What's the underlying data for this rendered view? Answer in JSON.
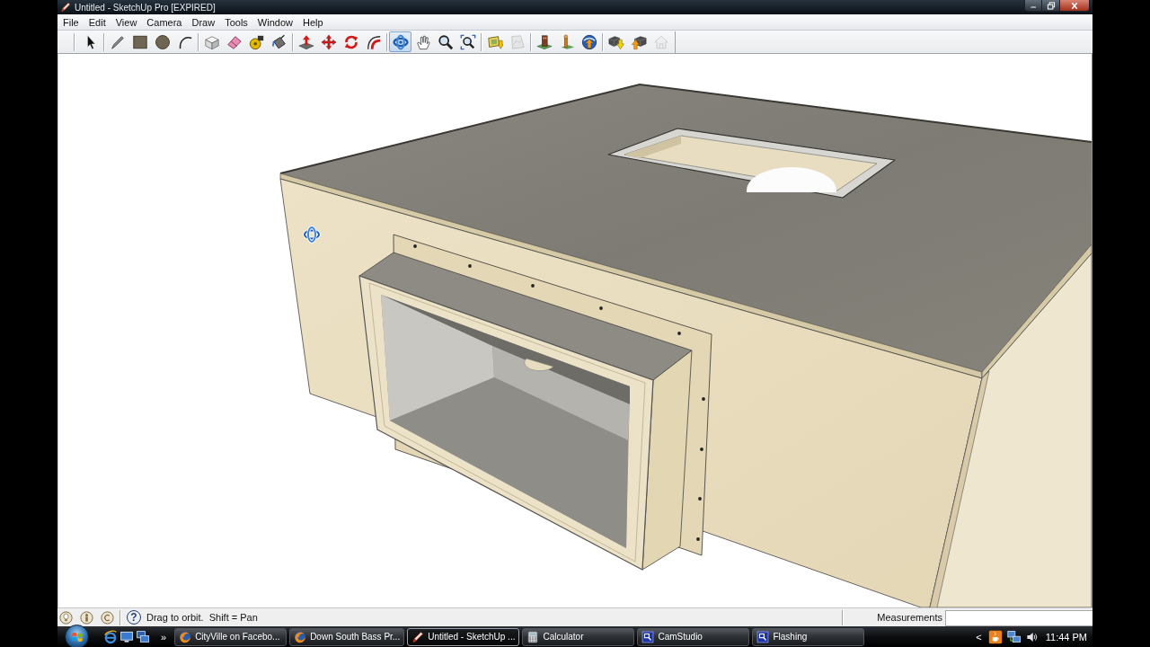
{
  "window": {
    "title": "Untitled - SketchUp Pro [EXPIRED]"
  },
  "menu": [
    "File",
    "Edit",
    "View",
    "Camera",
    "Draw",
    "Tools",
    "Window",
    "Help"
  ],
  "toolbar": {
    "groups": [
      {
        "tools": [
          {
            "kind": "arrow",
            "selected": false,
            "disabled": false
          }
        ]
      },
      {
        "tools": [
          {
            "kind": "pencil",
            "selected": false,
            "disabled": false
          },
          {
            "kind": "square",
            "selected": false,
            "disabled": false
          },
          {
            "kind": "circle",
            "selected": false,
            "disabled": false
          },
          {
            "kind": "arc",
            "selected": false,
            "disabled": false
          }
        ]
      },
      {
        "tools": [
          {
            "kind": "box",
            "selected": false,
            "disabled": false
          },
          {
            "kind": "eraser",
            "selected": false,
            "disabled": false
          },
          {
            "kind": "tape",
            "selected": false,
            "disabled": false
          },
          {
            "kind": "bucket",
            "selected": false,
            "disabled": false
          }
        ]
      },
      {
        "tools": [
          {
            "kind": "pushpull",
            "selected": false,
            "disabled": false
          },
          {
            "kind": "move",
            "selected": false,
            "disabled": false
          },
          {
            "kind": "rotate",
            "selected": false,
            "disabled": false
          },
          {
            "kind": "offset",
            "selected": false,
            "disabled": false
          }
        ]
      },
      {
        "tools": [
          {
            "kind": "orbit",
            "selected": true,
            "disabled": false
          },
          {
            "kind": "hand",
            "selected": false,
            "disabled": false
          },
          {
            "kind": "magnifier",
            "selected": false,
            "disabled": false
          },
          {
            "kind": "extents",
            "selected": false,
            "disabled": false
          }
        ]
      },
      {
        "tools": [
          {
            "kind": "photo",
            "selected": false,
            "disabled": false
          },
          {
            "kind": "terrain",
            "selected": false,
            "disabled": true
          }
        ]
      },
      {
        "tools": [
          {
            "kind": "building",
            "selected": false,
            "disabled": false
          },
          {
            "kind": "figure",
            "selected": false,
            "disabled": false
          },
          {
            "kind": "globe",
            "selected": false,
            "disabled": false
          }
        ]
      },
      {
        "tools": [
          {
            "kind": "download",
            "selected": false,
            "disabled": false
          },
          {
            "kind": "upload",
            "selected": false,
            "disabled": false
          },
          {
            "kind": "house",
            "selected": false,
            "disabled": true
          }
        ]
      }
    ]
  },
  "status_bar": {
    "help": "?",
    "hint": "Drag to orbit.  Shift = Pan",
    "measurements_label": "Measurements"
  },
  "taskbar": {
    "overflow": "»",
    "buttons": [
      {
        "kind": "browser",
        "label": "CityVille on Facebo...",
        "selected": false
      },
      {
        "kind": "browser",
        "label": "Down South Bass Pr...",
        "selected": false
      },
      {
        "kind": "sketch",
        "label": "Untitled - SketchUp ...",
        "selected": true
      },
      {
        "kind": "calculator",
        "label": "Calculator",
        "selected": false
      },
      {
        "kind": "capture",
        "label": "CamStudio",
        "selected": false
      },
      {
        "kind": "capture",
        "label": "Flashing",
        "selected": false
      }
    ],
    "tray": {
      "expand": "<",
      "clock": "11:44 PM"
    }
  }
}
